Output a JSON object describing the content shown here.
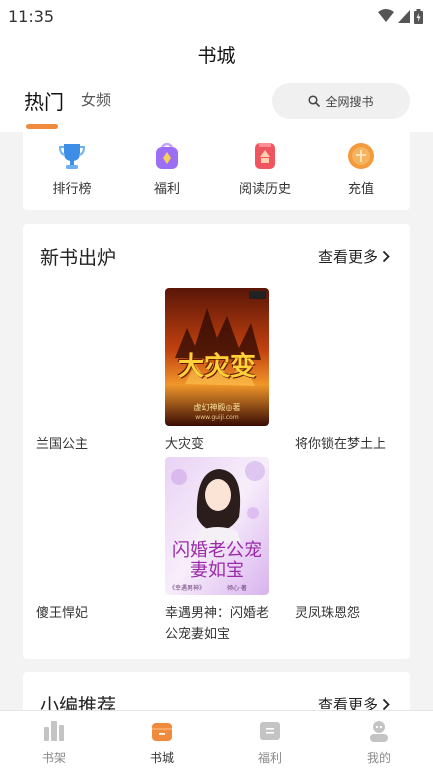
{
  "status_bar": {
    "time": "11:35"
  },
  "header": {
    "title": "书城"
  },
  "tabs": {
    "hot": "热门",
    "female": "女频"
  },
  "search": {
    "label": "全网搜书"
  },
  "quick_links": [
    {
      "label": "排行榜",
      "icon": "trophy-icon",
      "color": "#3d8ee6"
    },
    {
      "label": "福利",
      "icon": "gift-bag-icon",
      "color": "#9b6ef3"
    },
    {
      "label": "阅读历史",
      "icon": "history-icon",
      "color": "#f0545f"
    },
    {
      "label": "充值",
      "icon": "coin-icon",
      "color": "#f59a3c"
    }
  ],
  "new_books": {
    "title": "新书出炉",
    "more": "查看更多",
    "row1": [
      "兰国公主",
      "大灾变",
      "将你锁在梦土上"
    ],
    "row2": [
      "傻王悍妃",
      "幸遇男神：闪婚老公宠妻如宝",
      "灵凤珠恩怨"
    ],
    "covers": [
      {
        "title": "大灾变",
        "author": "虚幻神殿◎著",
        "site": "www.guiji.com"
      },
      {
        "title": "闪婚老公宠妻如宝",
        "series": "《幸遇男神》",
        "author": "倾心·著"
      }
    ]
  },
  "recommend": {
    "title": "小编推荐",
    "more": "查看更多"
  },
  "bottom_nav": [
    {
      "label": "书架",
      "icon": "bookshelf-icon",
      "active": false
    },
    {
      "label": "书城",
      "icon": "bookstore-icon",
      "active": true
    },
    {
      "label": "福利",
      "icon": "welfare-icon",
      "active": false
    },
    {
      "label": "我的",
      "icon": "profile-icon",
      "active": false
    }
  ],
  "colors": {
    "accent": "#f08a3c",
    "background": "#f3f3f3"
  }
}
